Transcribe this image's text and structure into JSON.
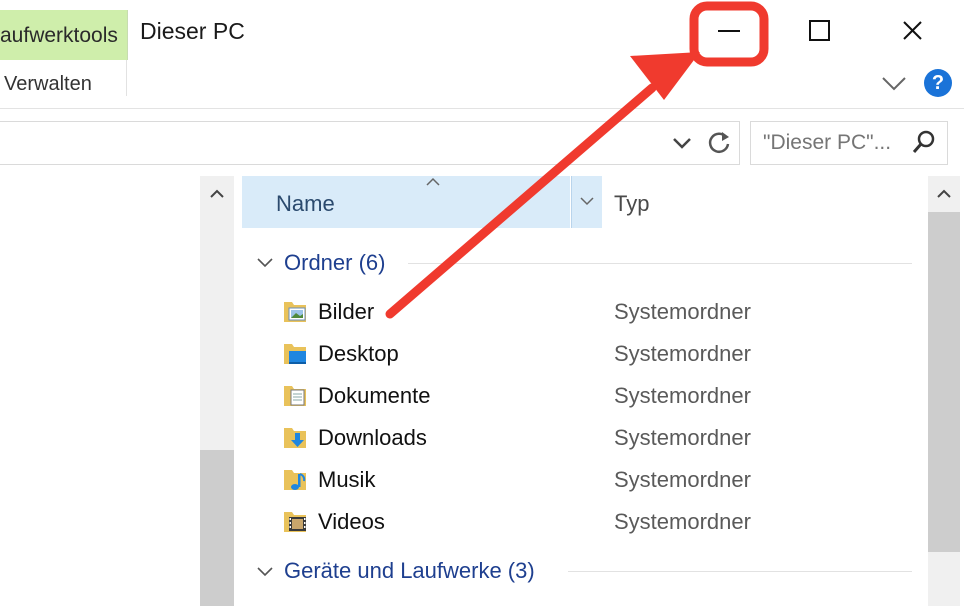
{
  "window": {
    "title": "Dieser PC",
    "context_tab": "Laufwerktools",
    "context_tab_visible": "aufwerktools",
    "manage_tab": "Verwalten",
    "help_label": "?"
  },
  "addressbar": {
    "search_placeholder": "\"Dieser PC\"..."
  },
  "nav": {
    "edge_text": ")"
  },
  "columns": {
    "name": "Name",
    "type": "Typ"
  },
  "groups": [
    {
      "label": "Ordner (6)"
    },
    {
      "label": "Geräte und Laufwerke (3)"
    }
  ],
  "items": [
    {
      "name": "Bilder",
      "type": "Systemordner",
      "icon": "pictures-folder-icon"
    },
    {
      "name": "Desktop",
      "type": "Systemordner",
      "icon": "desktop-folder-icon"
    },
    {
      "name": "Dokumente",
      "type": "Systemordner",
      "icon": "documents-folder-icon"
    },
    {
      "name": "Downloads",
      "type": "Systemordner",
      "icon": "downloads-folder-icon"
    },
    {
      "name": "Musik",
      "type": "Systemordner",
      "icon": "music-folder-icon"
    },
    {
      "name": "Videos",
      "type": "Systemordner",
      "icon": "videos-folder-icon"
    }
  ],
  "colors": {
    "annotation_red": "#f03a2e",
    "selected_header": "#d9ebf9",
    "context_tab": "#cfeeab",
    "group_text": "#1e3f8f",
    "help_blue": "#1a73d8"
  }
}
